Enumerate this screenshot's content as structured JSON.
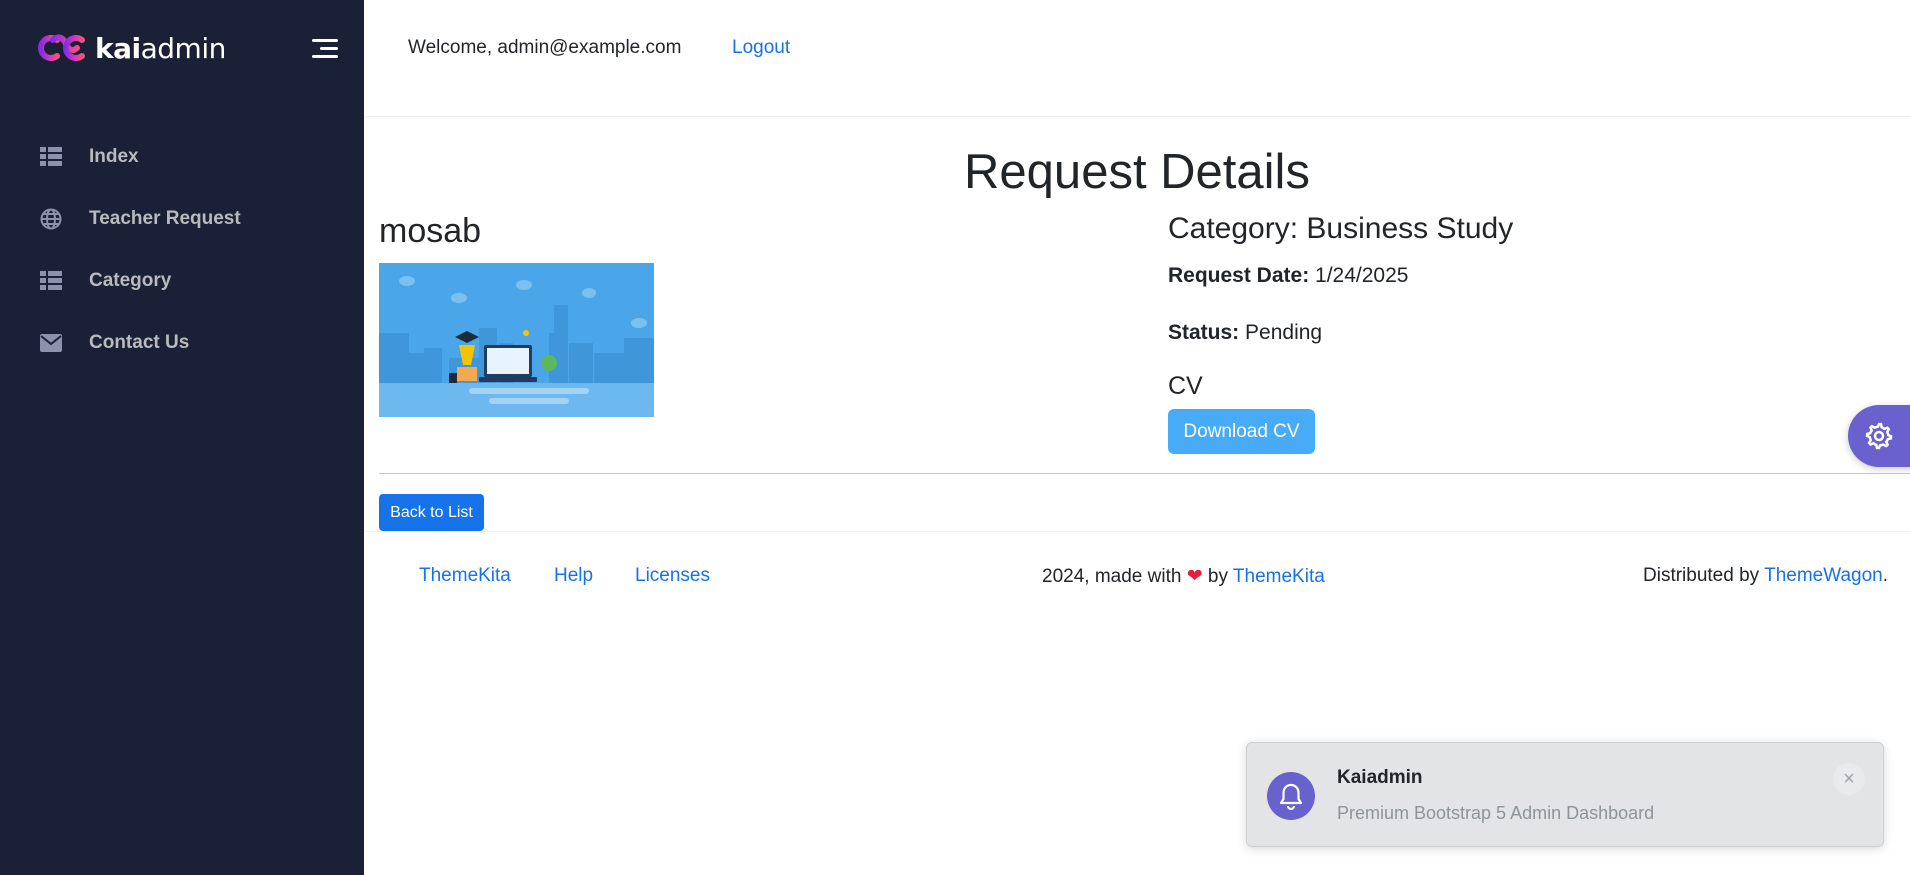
{
  "app": {
    "brand_bold": "kai",
    "brand_light": "admin"
  },
  "sidebar": {
    "items": [
      {
        "label": "Index",
        "icon": "table-icon"
      },
      {
        "label": "Teacher Request",
        "icon": "globe-icon"
      },
      {
        "label": "Category",
        "icon": "table-icon"
      },
      {
        "label": "Contact Us",
        "icon": "envelope-icon"
      }
    ]
  },
  "header": {
    "welcome": "Welcome, admin@example.com",
    "logout": "Logout"
  },
  "main": {
    "title": "Request Details",
    "name": "mosab",
    "category_label": "Category:",
    "category_value": "Business Study",
    "request_date_label": "Request Date:",
    "request_date_value": "1/24/2025",
    "status_label": "Status:",
    "status_value": "Pending",
    "cv_label": "CV",
    "download_button": "Download CV",
    "back_button": "Back to List"
  },
  "footer": {
    "links": [
      "ThemeKita",
      "Help",
      "Licenses"
    ],
    "credit_prefix": "2024, made with",
    "credit_by": "by",
    "credit_link": "ThemeKita",
    "distributed_prefix": "Distributed by",
    "distributed_link": "ThemeWagon",
    "distributed_suffix": "."
  },
  "toast": {
    "title": "Kaiadmin",
    "message": "Premium Bootstrap 5 Admin Dashboard",
    "close": "×"
  },
  "colors": {
    "sidebar_bg": "#1a2035",
    "primary": "#1572e8",
    "info": "#48abf7",
    "secondary": "#6861ce"
  }
}
